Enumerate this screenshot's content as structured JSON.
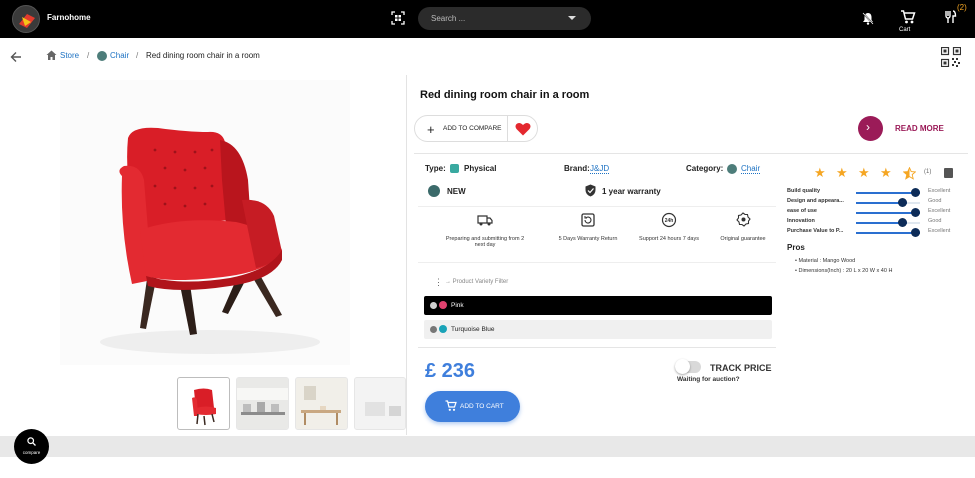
{
  "header": {
    "shop_name": "Farnohome",
    "search_placeholder": "Search ...",
    "cart_label": "Cart",
    "compare_count": "(2)"
  },
  "breadcrumb": {
    "items": [
      "Store",
      "Chair",
      "Red dining room chair in a room"
    ],
    "separator": "/"
  },
  "product": {
    "title": "Red dining room chair in a room",
    "add_to_compare": "ADD TO COMPARE",
    "read_more": "READ MORE",
    "type_label": "Type:",
    "type_value": "Physical",
    "brand_label": "Brand:",
    "brand_value": "J&JD",
    "category_label": "Category:",
    "category_value": "Chair",
    "condition": "NEW",
    "warranty": "1 year warranty",
    "features": [
      {
        "icon": "delivery-truck-icon",
        "text": "Preparing and submitting from 2 next day"
      },
      {
        "icon": "warranty-return-icon",
        "text": "5 Days Warranty Return"
      },
      {
        "icon": "support-24h-icon",
        "text": "Support 24 hours 7 days"
      },
      {
        "icon": "original-guarantee-icon",
        "text": "Original guarantee"
      }
    ],
    "variety_filter": "→ Product Variety Filter",
    "variants": [
      {
        "label": "Pink",
        "swatch": "#e0426f",
        "selected": true
      },
      {
        "label": "Turquoise Blue",
        "swatch": "#1aa3b8",
        "selected": false
      }
    ],
    "price": "£ 236",
    "track_price": "TRACK PRICE",
    "waiting_auction": "Waiting for auction?",
    "add_to_cart": "ADD TO CART"
  },
  "rating": {
    "stars": 4.5,
    "count": "(1)",
    "metrics": [
      {
        "label": "Build quality",
        "value": "Excellent",
        "level": 1.0
      },
      {
        "label": "Design and appeara...",
        "value": "Good",
        "level": 0.8
      },
      {
        "label": "ease of use",
        "value": "Excellent",
        "level": 1.0
      },
      {
        "label": "Innovation",
        "value": "Good",
        "level": 0.8
      },
      {
        "label": "Purchase Value to P...",
        "value": "Excellent",
        "level": 1.0
      }
    ],
    "pros_title": "Pros",
    "pros": [
      "Material : Mango Wood",
      "Dimensions(Inch) : 20 L x 20 W x 40 H"
    ]
  },
  "fab": {
    "label": "compare"
  },
  "colors": {
    "accent": "#3f7fdc",
    "brand": "#9b1b58",
    "star": "#f5a623",
    "chair": "#e1262c"
  }
}
